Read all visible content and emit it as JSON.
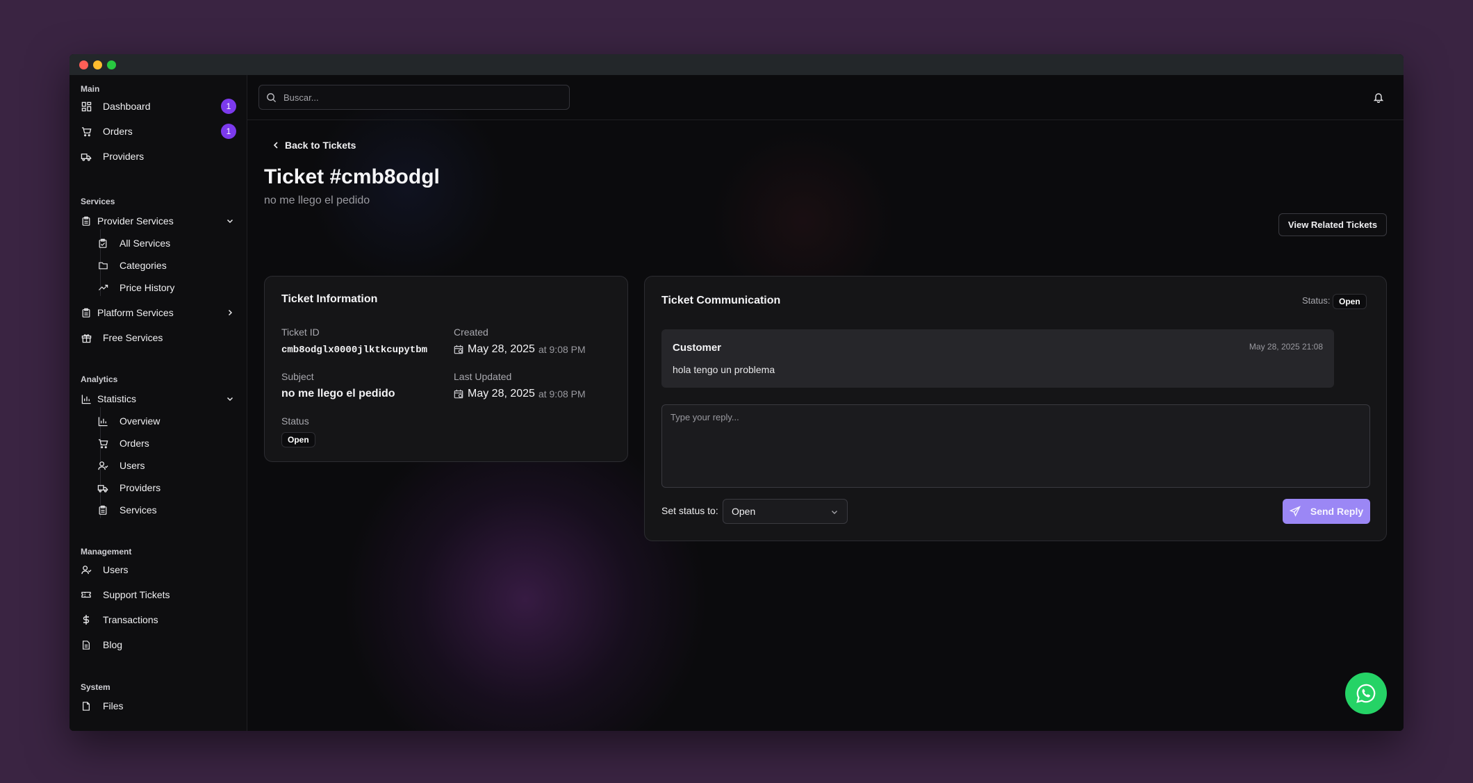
{
  "sidebar": {
    "sections": {
      "main": "Main",
      "services": "Services",
      "analytics": "Analytics",
      "management": "Management",
      "system": "System"
    },
    "main_items": [
      {
        "label": "Dashboard",
        "icon": "grid-icon",
        "badge": "1"
      },
      {
        "label": "Orders",
        "icon": "cart-icon",
        "badge": "1"
      },
      {
        "label": "Providers",
        "icon": "truck-icon"
      }
    ],
    "provider_services": {
      "label": "Provider Services",
      "children": [
        {
          "label": "All Services",
          "icon": "clipboard-icon"
        },
        {
          "label": "Categories",
          "icon": "folder-icon"
        },
        {
          "label": "Price History",
          "icon": "trending-icon"
        }
      ]
    },
    "platform_services": {
      "label": "Platform Services"
    },
    "free_services": {
      "label": "Free Services"
    },
    "statistics": {
      "label": "Statistics",
      "children": [
        {
          "label": "Overview",
          "icon": "bar-chart-icon"
        },
        {
          "label": "Orders",
          "icon": "cart-icon"
        },
        {
          "label": "Users",
          "icon": "users-icon"
        },
        {
          "label": "Providers",
          "icon": "truck-icon"
        },
        {
          "label": "Services",
          "icon": "clipboard-icon"
        }
      ]
    },
    "management_items": [
      {
        "label": "Users",
        "icon": "users-icon"
      },
      {
        "label": "Support Tickets",
        "icon": "ticket-icon"
      },
      {
        "label": "Transactions",
        "icon": "dollar-icon"
      },
      {
        "label": "Blog",
        "icon": "document-icon"
      }
    ],
    "system_items": [
      {
        "label": "Files",
        "icon": "file-icon"
      }
    ]
  },
  "topbar": {
    "search_placeholder": "Buscar..."
  },
  "page": {
    "back_label": "Back to Tickets",
    "title": "Ticket #cmb8odgl",
    "subtitle": "no me llego el pedido",
    "related_button": "View Related Tickets"
  },
  "info": {
    "title": "Ticket Information",
    "ticket_id_label": "Ticket ID",
    "ticket_id": "cmb8odglx0000jlktkcupytbm",
    "created_label": "Created",
    "created_date": "May 28, 2025",
    "created_time": "at 9:08 PM",
    "subject_label": "Subject",
    "subject": "no me llego el pedido",
    "updated_label": "Last Updated",
    "updated_date": "May 28, 2025",
    "updated_time": "at 9:08 PM",
    "status_label": "Status",
    "status": "Open"
  },
  "communication": {
    "title": "Ticket Communication",
    "status_label": "Status:",
    "status": "Open",
    "messages": [
      {
        "author": "Customer",
        "time": "May 28, 2025 21:08",
        "text": "hola tengo un problema"
      }
    ],
    "reply_placeholder": "Type your reply...",
    "set_status_label": "Set status to:",
    "set_status_value": "Open",
    "send_label": "Send Reply"
  },
  "colors": {
    "accent": "#7c3aed",
    "send_button": "#9b87f5",
    "whatsapp": "#25d366",
    "background": "#3a2442"
  }
}
